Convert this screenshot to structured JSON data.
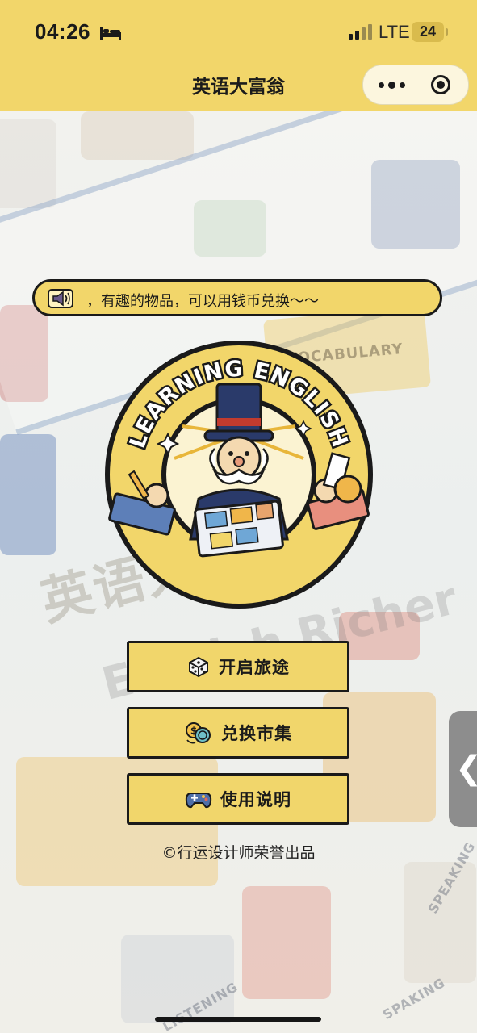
{
  "status_bar": {
    "time": "04:26",
    "network": "LTE",
    "battery": "24"
  },
  "nav": {
    "title": "英语大富翁"
  },
  "notice": {
    "text": "，有趣的物品，可以用钱币兑换～～"
  },
  "logo": {
    "arc_text": "LEARNING ENGLISH"
  },
  "menu": [
    {
      "label": "开启旅途",
      "icon": "dice-icon"
    },
    {
      "label": "兑换市集",
      "icon": "coins-icon"
    },
    {
      "label": "使用说明",
      "icon": "gamepad-icon"
    }
  ],
  "footer": {
    "text": "©行运设计师荣誉出品"
  },
  "side_handle": {
    "glyph": "❮"
  },
  "background": {
    "board_label": "VOCABULARY",
    "big_text": "英语大富翁",
    "big_text_en": "English Richer",
    "words": [
      "LISTENING",
      "SPAKING",
      "SPEAKING"
    ]
  },
  "colors": {
    "accent": "#f2d66a",
    "ink": "#1a1a1a"
  }
}
